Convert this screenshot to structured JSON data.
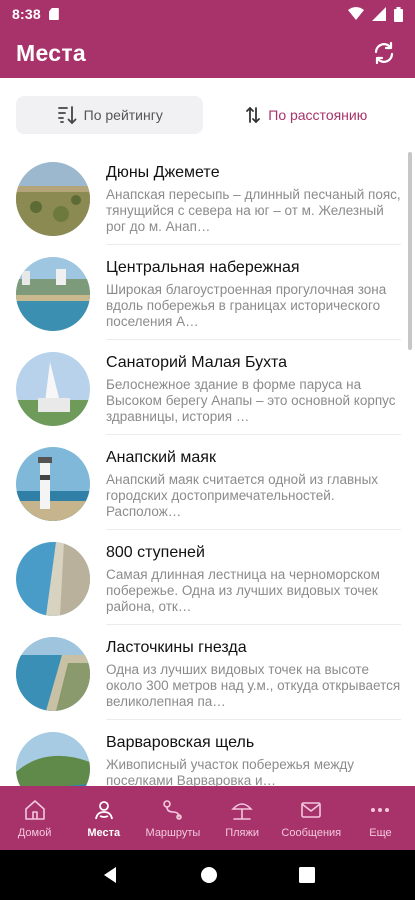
{
  "status_bar": {
    "time": "8:38"
  },
  "app_bar": {
    "title": "Места"
  },
  "sort": {
    "by_rating": "По рейтингу",
    "by_distance": "По расстоянию"
  },
  "places": [
    {
      "title": "Дюны Джеметe",
      "description": "Анапская пересыпь – длинный песчаный пояс, тянущийся с севера на юг – от м. Железный рог до м. Анап…"
    },
    {
      "title": "Центральная набережная",
      "description": "Широкая благоустроенная прогулочная зона вдоль побережья в границах исторического поселения А…"
    },
    {
      "title": "Санаторий Малая Бухта",
      "description": "Белоснежное здание в форме паруса на Высоком берегу Анапы – это основной корпус здравницы, история …"
    },
    {
      "title": "Анапский маяк",
      "description": "Анапский маяк считается одной из главных городских достопримечательностей. Располож…"
    },
    {
      "title": "800 ступеней",
      "description": "Самая длинная лестница на черноморском побережье. Одна из лучших видовых точек района, отк…"
    },
    {
      "title": "Ласточкины гнезда",
      "description": "Одна из лучших видовых точек на высоте около 300 метров над у.м., откуда открывается великолепная па…"
    },
    {
      "title": "Варваровская щель",
      "description": "Живописный участок побережья между поселками Варваровка и…"
    }
  ],
  "bottom_nav": [
    {
      "label": "Домой",
      "icon": "home-icon"
    },
    {
      "label": "Места",
      "icon": "place-icon"
    },
    {
      "label": "Маршруты",
      "icon": "route-icon"
    },
    {
      "label": "Пляжи",
      "icon": "umbrella-icon"
    },
    {
      "label": "Сообщения",
      "icon": "mail-icon"
    },
    {
      "label": "Еще",
      "icon": "more-icon"
    }
  ],
  "colors": {
    "brand": "#a8336b",
    "inactive_nav": "#f2c8dd"
  }
}
